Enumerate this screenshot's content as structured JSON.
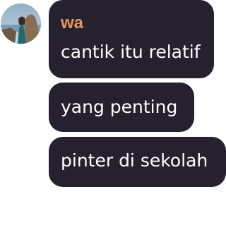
{
  "chat": {
    "sender": {
      "name": "wa",
      "name_color": "#e8955c",
      "avatar_icon": "profile-photo"
    },
    "bubble_color": "#26212f",
    "messages": [
      {
        "text": "cantik itu relatif"
      },
      {
        "text": "yang penting"
      },
      {
        "text": "pinter di sekolah"
      }
    ]
  }
}
